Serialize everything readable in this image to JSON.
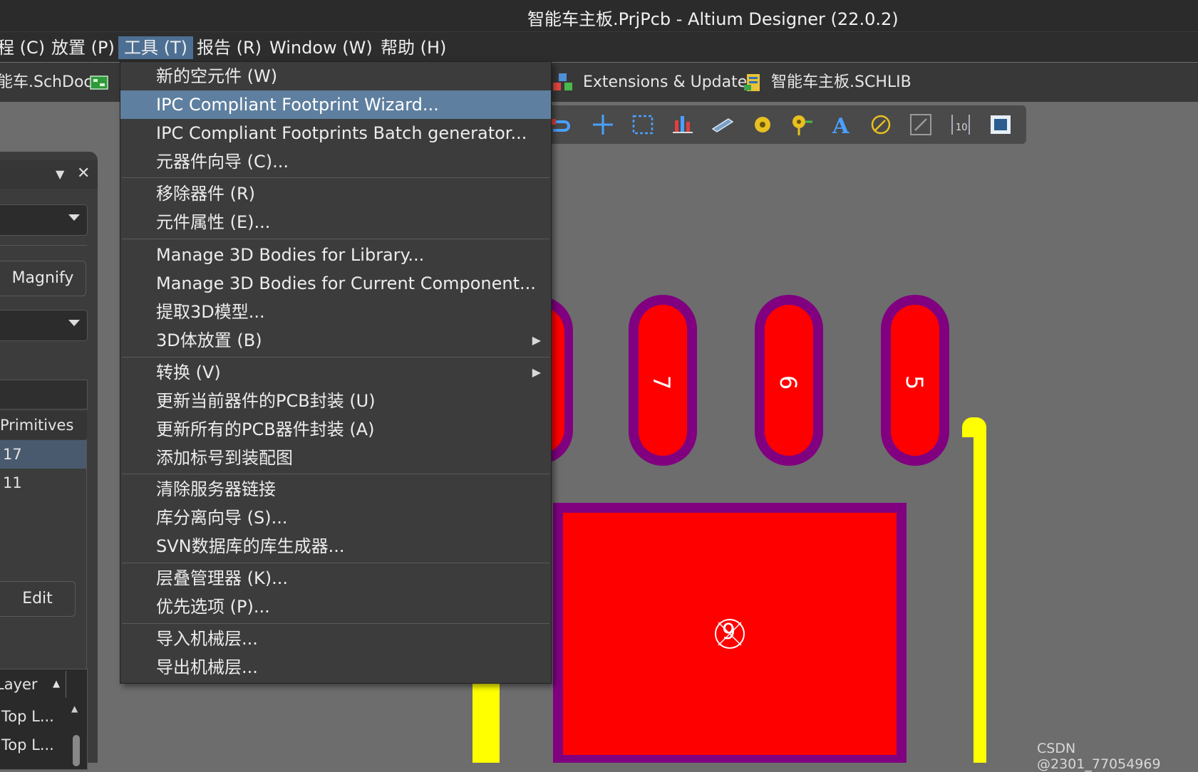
{
  "window": {
    "title": "智能车主板.PrjPcb - Altium Designer (22.0.2)"
  },
  "menubar": [
    {
      "label": "程 (C)"
    },
    {
      "label": "放置 (P)"
    },
    {
      "label": "工具 (T)"
    },
    {
      "label": "报告 (R)"
    },
    {
      "label": "Window (W)"
    },
    {
      "label": "帮助 (H)"
    }
  ],
  "tabs": {
    "schdoc": "能车.SchDoc",
    "extensions": "Extensions & Updates",
    "schlib": "智能车主板.SCHLIB"
  },
  "left_panel": {
    "magnify_label": "Magnify",
    "primitives_label": "Primitives",
    "rows": [
      "17",
      "11"
    ],
    "edit_label": "Edit",
    "layer_header": "Layer",
    "layer_rows": [
      "Top L...",
      "Top L..."
    ]
  },
  "tools_menu": {
    "items": [
      {
        "label": "新的空元件 (W)"
      },
      {
        "label": "IPC Compliant Footprint Wizard...",
        "highlighted": true
      },
      {
        "label": "IPC Compliant Footprints Batch generator..."
      },
      {
        "label": "元器件向导 (C)..."
      },
      {
        "label": "移除器件 (R)"
      },
      {
        "label": "元件属性 (E)..."
      },
      {
        "label": "Manage 3D Bodies for Library..."
      },
      {
        "label": "Manage 3D Bodies for Current Component..."
      },
      {
        "label": "提取3D模型..."
      },
      {
        "label": "3D体放置 (B)",
        "submenu": true
      },
      {
        "label": "转换 (V)",
        "submenu": true
      },
      {
        "label": "更新当前器件的PCB封装 (U)"
      },
      {
        "label": "更新所有的PCB器件封装 (A)"
      },
      {
        "label": "添加标号到装配图"
      },
      {
        "label": "清除服务器链接"
      },
      {
        "label": "库分离向导 (S)..."
      },
      {
        "label": "SVN数据库的库生成器..."
      },
      {
        "label": "层叠管理器 (K)..."
      },
      {
        "label": "优先选项 (P)..."
      },
      {
        "label": "导入机械层..."
      },
      {
        "label": "导出机械层..."
      }
    ]
  },
  "pcb": {
    "pads": [
      "7",
      "6",
      "5"
    ],
    "center_pad": "9",
    "colors": {
      "pad": "#ff0000",
      "mask": "#800080",
      "track": "#ffff00",
      "background": "#6d6d6d"
    }
  },
  "annotation": {
    "color": "#19c9d2"
  },
  "watermark": "CSDN @2301_77054969"
}
